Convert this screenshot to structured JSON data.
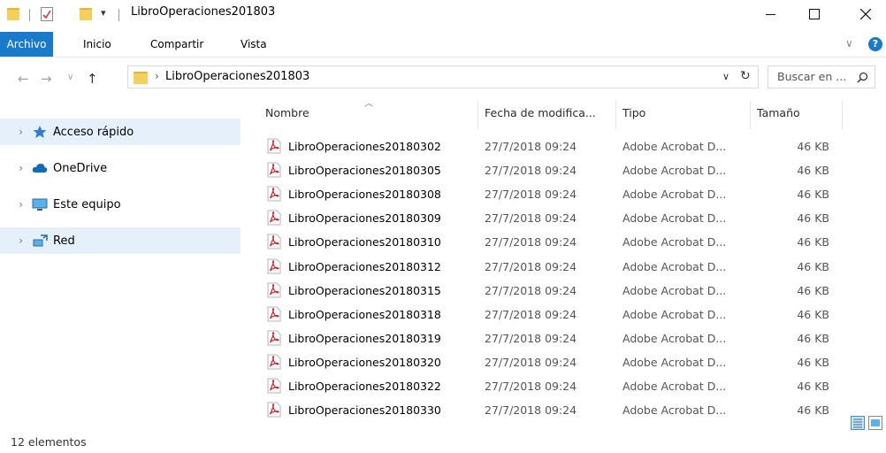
{
  "window": {
    "title": "LibroOperaciones201803"
  },
  "ribbon": {
    "tabs": [
      "Archivo",
      "Inicio",
      "Compartir",
      "Vista"
    ]
  },
  "address": {
    "path": "LibroOperaciones201803",
    "search_placeholder": "Buscar en ..."
  },
  "sidebar": {
    "items": [
      {
        "label": "Acceso rápido",
        "icon": "star-icon"
      },
      {
        "label": "OneDrive",
        "icon": "cloud-icon"
      },
      {
        "label": "Este equipo",
        "icon": "computer-icon"
      },
      {
        "label": "Red",
        "icon": "network-icon"
      }
    ]
  },
  "columns": [
    "Nombre",
    "Fecha de modifica...",
    "Tipo",
    "Tamaño"
  ],
  "files": [
    {
      "name": "LibroOperaciones20180302",
      "date": "27/7/2018 09:24",
      "type": "Adobe Acrobat D...",
      "size": "46 KB"
    },
    {
      "name": "LibroOperaciones20180305",
      "date": "27/7/2018 09:24",
      "type": "Adobe Acrobat D...",
      "size": "46 KB"
    },
    {
      "name": "LibroOperaciones20180308",
      "date": "27/7/2018 09:24",
      "type": "Adobe Acrobat D...",
      "size": "46 KB"
    },
    {
      "name": "LibroOperaciones20180309",
      "date": "27/7/2018 09:24",
      "type": "Adobe Acrobat D...",
      "size": "46 KB"
    },
    {
      "name": "LibroOperaciones20180310",
      "date": "27/7/2018 09:24",
      "type": "Adobe Acrobat D...",
      "size": "46 KB"
    },
    {
      "name": "LibroOperaciones20180312",
      "date": "27/7/2018 09:24",
      "type": "Adobe Acrobat D...",
      "size": "46 KB"
    },
    {
      "name": "LibroOperaciones20180315",
      "date": "27/7/2018 09:24",
      "type": "Adobe Acrobat D...",
      "size": "46 KB"
    },
    {
      "name": "LibroOperaciones20180318",
      "date": "27/7/2018 09:24",
      "type": "Adobe Acrobat D...",
      "size": "46 KB"
    },
    {
      "name": "LibroOperaciones20180319",
      "date": "27/7/2018 09:24",
      "type": "Adobe Acrobat D...",
      "size": "46 KB"
    },
    {
      "name": "LibroOperaciones20180320",
      "date": "27/7/2018 09:24",
      "type": "Adobe Acrobat D...",
      "size": "46 KB"
    },
    {
      "name": "LibroOperaciones20180322",
      "date": "27/7/2018 09:24",
      "type": "Adobe Acrobat D...",
      "size": "46 KB"
    },
    {
      "name": "LibroOperaciones20180330",
      "date": "27/7/2018 09:24",
      "type": "Adobe Acrobat D...",
      "size": "46 KB"
    }
  ],
  "status": {
    "count_text": "12 elementos"
  },
  "colors": {
    "accent": "#1979ca",
    "selection": "#e5f0fb"
  }
}
